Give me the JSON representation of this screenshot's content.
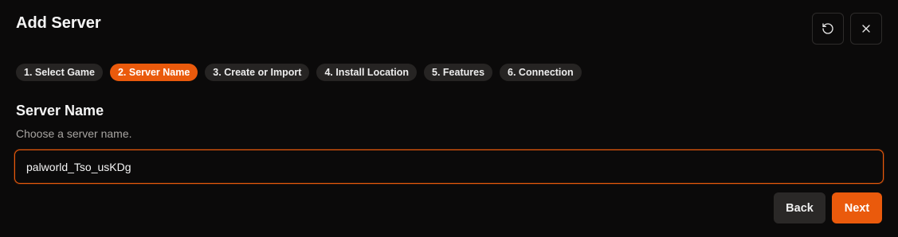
{
  "dialog": {
    "title": "Add Server"
  },
  "steps": [
    {
      "label": "1. Select Game",
      "active": false
    },
    {
      "label": "2. Server Name",
      "active": true
    },
    {
      "label": "3. Create or Import",
      "active": false
    },
    {
      "label": "4. Install Location",
      "active": false
    },
    {
      "label": "5. Features",
      "active": false
    },
    {
      "label": "6. Connection",
      "active": false
    }
  ],
  "section": {
    "title": "Server Name",
    "description": "Choose a server name."
  },
  "server_name_input": {
    "value": "palworld_Tso_usKDg"
  },
  "footer": {
    "back_label": "Back",
    "next_label": "Next"
  },
  "icons": {
    "reset": "rotate-ccw-icon",
    "close": "close-icon"
  },
  "colors": {
    "accent": "#ea5a0c",
    "background": "#0b0a0a",
    "pill": "#262423"
  }
}
